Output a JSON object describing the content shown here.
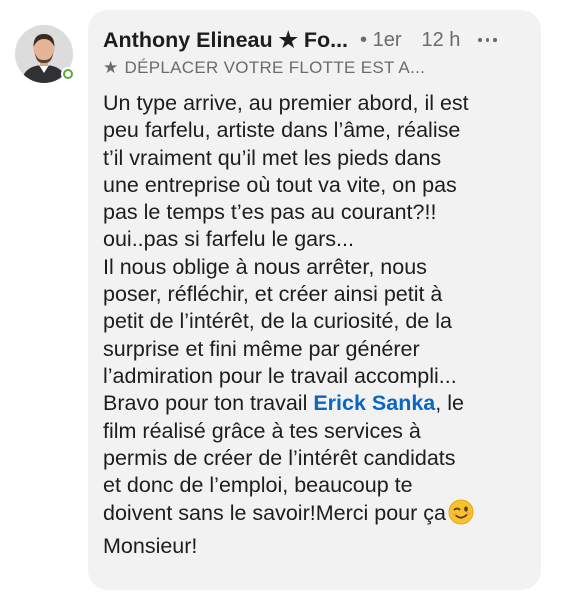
{
  "comment": {
    "author": {
      "name_display": "Anthony Elineau ★ Fo...",
      "headline_display": "DÉPLACER VOTRE FLOTTE EST A...",
      "degree": "• 1er",
      "time": "12 h",
      "online_status_color": "#5ea83a"
    },
    "body": {
      "lines": [
        "Un type arrive, au premier abord, il est",
        "peu farfelu, artiste dans l’âme, réalise",
        "t’il vraiment qu’il met les pieds dans",
        "une entreprise où tout va vite, on pas",
        "pas le temps t’es pas au courant?!!",
        "oui..pas si farfelu le gars...",
        "Il nous oblige à nous arrêter, nous",
        "poser, réfléchir, et créer ainsi petit à",
        "petit de l’intérêt,  de la curiosité, de la",
        "surprise et fini même par générer",
        "l’admiration pour le travail accompli..."
      ],
      "mention_before": "Bravo pour ton travail ",
      "mention_name": "Erick Sanka",
      "mention_after": ", le",
      "lines_after": [
        "film réalisé grâce à tes services à",
        "permis de créer de l’intérêt candidats",
        "et donc de l’emploi, beaucoup te"
      ],
      "last_line_before_emoji": "doivent sans le savoir!Merci pour ça",
      "final_line": "Monsieur!"
    },
    "icons": {
      "avatar": "avatar-photo",
      "headline_star": "star-icon",
      "more": "more-options-icon",
      "emoji": "winking-face-icon",
      "presence": "online-status-icon"
    },
    "colors": {
      "mention": "#0a66c2",
      "card_background": "#f2f2f2",
      "secondary_text": "#6b6b6b",
      "primary_text": "#1d1d1d"
    }
  }
}
